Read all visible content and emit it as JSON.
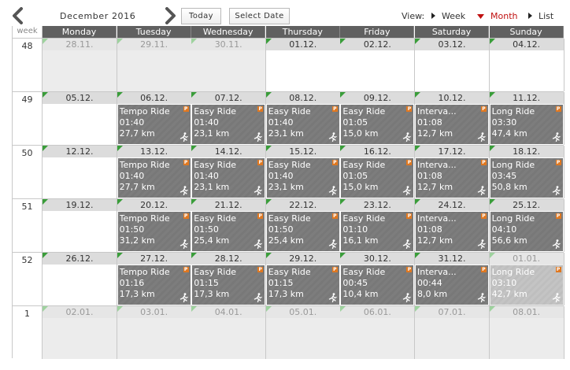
{
  "toolbar": {
    "month_label": "December 2016",
    "today_label": "Today",
    "select_date_label": "Select Date",
    "view_label": "View:",
    "views": [
      {
        "label": "Week",
        "active": false
      },
      {
        "label": "Month",
        "active": true
      },
      {
        "label": "List",
        "active": false
      }
    ]
  },
  "colors": {
    "active_view": "#c01010",
    "header_bg": "#606060",
    "workout_bg": "#7d7d7d",
    "corner_marker": "#3a9d3a",
    "badge": "#e07820"
  },
  "calendar": {
    "week_header": "week",
    "days": [
      "Monday",
      "Tuesday",
      "Wednesday",
      "Thursday",
      "Friday",
      "Saturday",
      "Sunday"
    ],
    "weeks": [
      {
        "num": "48",
        "dates": [
          "28.11.",
          "29.11.",
          "30.11.",
          "01.12.",
          "02.12.",
          "03.12.",
          "04.12."
        ],
        "other_month": [
          true,
          true,
          true,
          false,
          false,
          false,
          false
        ],
        "workouts": [
          null,
          null,
          null,
          null,
          null,
          null,
          null
        ]
      },
      {
        "num": "49",
        "dates": [
          "05.12.",
          "06.12.",
          "07.12.",
          "08.12.",
          "09.12.",
          "10.12.",
          "11.12."
        ],
        "other_month": [
          false,
          false,
          false,
          false,
          false,
          false,
          false
        ],
        "workouts": [
          null,
          {
            "name": "Tempo Ride",
            "duration": "01:40",
            "distance": "27,7 km"
          },
          {
            "name": "Easy Ride",
            "duration": "01:40",
            "distance": "23,1 km"
          },
          {
            "name": "Easy Ride",
            "duration": "01:40",
            "distance": "23,1 km"
          },
          {
            "name": "Easy Ride",
            "duration": "01:05",
            "distance": "15,0 km"
          },
          {
            "name": "Interva...",
            "duration": "01:08",
            "distance": "12,7 km"
          },
          {
            "name": "Long Ride",
            "duration": "03:30",
            "distance": "47,4 km"
          }
        ]
      },
      {
        "num": "50",
        "dates": [
          "12.12.",
          "13.12.",
          "14.12.",
          "15.12.",
          "16.12.",
          "17.12.",
          "18.12."
        ],
        "other_month": [
          false,
          false,
          false,
          false,
          false,
          false,
          false
        ],
        "workouts": [
          null,
          {
            "name": "Tempo Ride",
            "duration": "01:40",
            "distance": "27,7 km"
          },
          {
            "name": "Easy Ride",
            "duration": "01:40",
            "distance": "23,1 km"
          },
          {
            "name": "Easy Ride",
            "duration": "01:40",
            "distance": "23,1 km"
          },
          {
            "name": "Easy Ride",
            "duration": "01:05",
            "distance": "15,0 km"
          },
          {
            "name": "Interva...",
            "duration": "01:08",
            "distance": "12,7 km"
          },
          {
            "name": "Long Ride",
            "duration": "03:45",
            "distance": "50,8 km"
          }
        ]
      },
      {
        "num": "51",
        "dates": [
          "19.12.",
          "20.12.",
          "21.12.",
          "22.12.",
          "23.12.",
          "24.12.",
          "25.12."
        ],
        "other_month": [
          false,
          false,
          false,
          false,
          false,
          false,
          false
        ],
        "workouts": [
          null,
          {
            "name": "Tempo Ride",
            "duration": "01:50",
            "distance": "31,2 km"
          },
          {
            "name": "Easy Ride",
            "duration": "01:50",
            "distance": "25,4 km"
          },
          {
            "name": "Easy Ride",
            "duration": "01:50",
            "distance": "25,4 km"
          },
          {
            "name": "Easy Ride",
            "duration": "01:10",
            "distance": "16,1 km"
          },
          {
            "name": "Interva...",
            "duration": "01:08",
            "distance": "12,7 km"
          },
          {
            "name": "Long Ride",
            "duration": "04:10",
            "distance": "56,6 km"
          }
        ]
      },
      {
        "num": "52",
        "dates": [
          "26.12.",
          "27.12.",
          "28.12.",
          "29.12.",
          "30.12.",
          "31.12.",
          "01.01."
        ],
        "other_month": [
          false,
          false,
          false,
          false,
          false,
          false,
          true
        ],
        "workouts": [
          null,
          {
            "name": "Tempo Ride",
            "duration": "01:16",
            "distance": "17,3 km"
          },
          {
            "name": "Easy Ride",
            "duration": "01:15",
            "distance": "17,3 km"
          },
          {
            "name": "Easy Ride",
            "duration": "01:15",
            "distance": "17,3 km"
          },
          {
            "name": "Easy Ride",
            "duration": "00:45",
            "distance": "10,4 km"
          },
          {
            "name": "Interva...",
            "duration": "00:44",
            "distance": "8,0 km"
          },
          {
            "name": "Long Ride",
            "duration": "03:10",
            "distance": "42,7 km"
          }
        ]
      },
      {
        "num": "1",
        "dates": [
          "02.01.",
          "03.01.",
          "04.01.",
          "05.01.",
          "06.01.",
          "07.01.",
          "08.01."
        ],
        "other_month": [
          true,
          true,
          true,
          true,
          true,
          true,
          true
        ],
        "workouts": [
          null,
          null,
          null,
          null,
          null,
          null,
          null
        ]
      }
    ],
    "badge_label": "P",
    "icons": {
      "prev": "chevron-left-icon",
      "next": "chevron-right-icon",
      "workout": "runner-icon",
      "view": "triangle-icon"
    }
  }
}
